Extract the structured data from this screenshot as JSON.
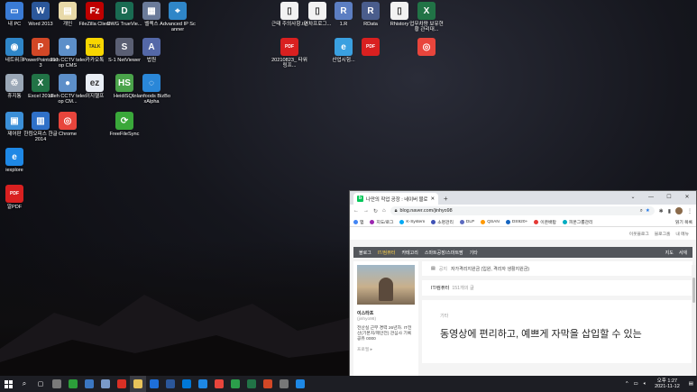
{
  "desktop_icons": [
    {
      "label": "내 PC",
      "glyph": "▭",
      "color": "#3a7bd5"
    },
    {
      "label": "Word 2013",
      "glyph": "W",
      "color": "#2b579a"
    },
    {
      "label": "개인",
      "glyph": "▤",
      "color": "#e8d9a8"
    },
    {
      "label": "FileZilla Client",
      "glyph": "Fz",
      "color": "#bf0000"
    },
    {
      "label": "DWG TrueVie...",
      "glyph": "D",
      "color": "#1a6b52"
    },
    {
      "label": "벨렉스",
      "glyph": "▦",
      "color": "#6b7b9a"
    },
    {
      "label": "Advanced IP Scanner",
      "glyph": "⌖",
      "color": "#2f86c8"
    },
    {
      "label": "네트워크",
      "glyph": "◉",
      "color": "#2f86c8"
    },
    {
      "label": "PowerPoint 2013",
      "glyph": "P",
      "color": "#d24726"
    },
    {
      "label": "olleh CCTV telecop CMS",
      "glyph": "●",
      "color": "#5d8fc9"
    },
    {
      "label": "카카오톡",
      "glyph": "TALK",
      "color": "#f7d600"
    },
    {
      "label": "S-1 NetViewer",
      "glyph": "S",
      "color": "#5a5f73"
    },
    {
      "label": "법원",
      "glyph": "A",
      "color": "#5468a8"
    },
    {
      "label": "휴지통",
      "glyph": "♲",
      "color": "#9aa7b6"
    },
    {
      "label": "Excel 2013",
      "glyph": "X",
      "color": "#217346"
    },
    {
      "label": "olleh CCTV telecop CM...",
      "glyph": "●",
      "color": "#5d8fc9"
    },
    {
      "label": "이지헬프",
      "glyph": "ez",
      "color": "#e9eef5"
    },
    {
      "label": "HeidiSQL",
      "glyph": "HS",
      "color": "#4aa34a"
    },
    {
      "label": "Inlanfoods BizBoxAlpha",
      "glyph": "◌",
      "color": "#2a87d8"
    },
    {
      "label": "제어판",
      "glyph": "▣",
      "color": "#3b8fd8"
    },
    {
      "label": "한컴오피스 한글 2014",
      "glyph": "▥",
      "color": "#2f70c8"
    },
    {
      "label": "Chrome",
      "glyph": "◎",
      "color": "#e8453c"
    },
    {
      "label": "FreeFileSync",
      "glyph": "⟳",
      "color": "#3aa83a"
    },
    {
      "label": "iexplore",
      "glyph": "e",
      "color": "#1e88e5"
    },
    {
      "label": "알PDF",
      "glyph": "PDF",
      "color": "#d92020"
    },
    {
      "label": "근태 주의사항.txt",
      "glyph": "▯",
      "color": "#f2f2f2"
    },
    {
      "label": "연차프로그...",
      "glyph": "▯",
      "color": "#f2f2f2"
    },
    {
      "label": "1.R",
      "glyph": "R",
      "color": "#5c7ec2"
    },
    {
      "label": "RData",
      "glyph": "R",
      "color": "#4a5d8c"
    },
    {
      "label": "Rhistory",
      "glyph": "▯",
      "color": "#f2f2f2"
    },
    {
      "label": "업무차량 보유현황 관리대...",
      "glyph": "X",
      "color": "#217346"
    },
    {
      "label": "20210823_ 타워링프...",
      "glyph": "PDF",
      "color": "#d92020"
    },
    {
      "label": "산업시험...",
      "glyph": "e",
      "color": "#3aa0e0"
    },
    {
      "label": "",
      "glyph": "PDF",
      "color": "#d92020"
    },
    {
      "label": "",
      "glyph": "◎",
      "color": "#e8453c"
    }
  ],
  "browser": {
    "tab_title": "나만의 작업 공장 : 네이버 블로그",
    "url": "blog.naver.com/jinhyo98",
    "bookmarks": [
      "앱",
      "지도/로그",
      "K-System",
      "소명관리",
      "DLP",
      "QSAN",
      "DS920+",
      "이온배탑",
      "피몬그룹관리"
    ],
    "bookmarks_right": "읽기 목록",
    "blog_top": [
      "이웃블로그",
      "블로그홈",
      "내 메뉴"
    ],
    "nav": [
      "블로그",
      "IT/컴퓨터",
      "카테고리",
      "스마트공장/스마트팜",
      "기타"
    ],
    "nav_right": [
      "지도",
      "서재"
    ],
    "profile_name": "이스타프",
    "profile_id": "(jinhyo98)",
    "profile_desc": "전산실 근무 경력 26년차. IT전산(기본지/제안전) 관심사 기록 공유 0000",
    "profile_more": "프로필 ▸",
    "notice_tag": "공지",
    "notice_text": "자가격리지원금 (입원, 격리자 생활지원금)",
    "category_title": "IT/컴퓨터",
    "category_count": "151개의 글",
    "post_category": "기타",
    "post_title": "동영상에 편리하고, 예쁘게 자막을 삽입할 수 있는"
  },
  "taskbar": {
    "time": "오후 1:27",
    "date": "2021-11-12"
  }
}
